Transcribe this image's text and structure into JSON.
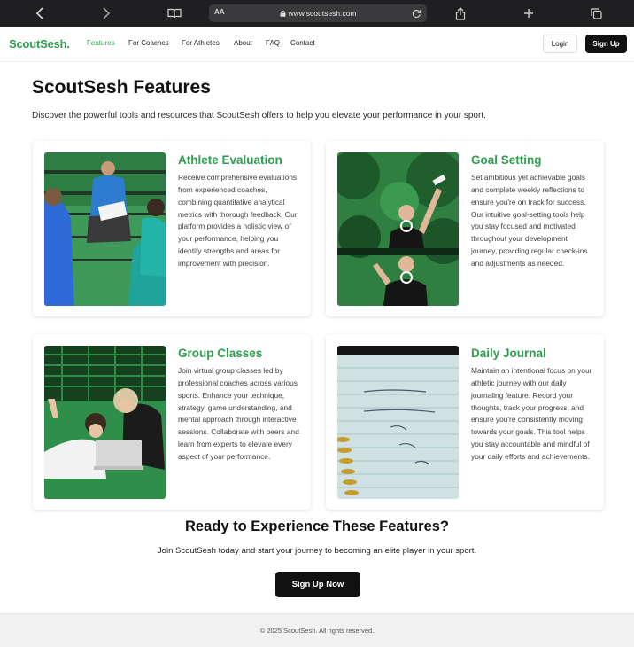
{
  "browser": {
    "text_size_label": "AA",
    "url": "www.scoutsesh.com"
  },
  "nav": {
    "logo": "ScoutSesh.",
    "links": [
      "Features",
      "For Coaches",
      "For Athletes",
      "About",
      "FAQ",
      "Contact"
    ],
    "active_link": "Features",
    "login_label": "Login",
    "signup_label": "Sign Up"
  },
  "page": {
    "title": "ScoutSesh Features",
    "intro": "Discover the powerful tools and resources that ScoutSesh offers to help you elevate your performance in your sport."
  },
  "features": [
    {
      "title": "Athlete Evaluation",
      "description": "Receive comprehensive evaluations from experienced coaches, combining quantitative analytical metrics with thorough feedback. Our platform provides a holistic view of your performance, helping you identify strengths and areas for improvement with precision.",
      "image_alt": "coach-evaluating-athletes-photo"
    },
    {
      "title": "Goal Setting",
      "description": "Set ambitious yet achievable goals and complete weekly reflections to ensure you're on track for success. Our intuitive goal-setting tools help you stay focused and motivated throughout your development journey, providing regular check-ins and adjustments as needed.",
      "image_alt": "athlete-celebrating-photo"
    },
    {
      "title": "Group Classes",
      "description": "Join virtual group classes led by professional coaches across various sports. Enhance your technique, strategy, game understanding, and mental approach through interactive sessions. Collaborate with peers and learn from experts to elevate every aspect of your performance.",
      "image_alt": "athletes-with-laptop-photo"
    },
    {
      "title": "Daily Journal",
      "description": "Maintain an intentional focus on your athletic journey with our daily journaling feature. Record your thoughts, track your progress, and ensure you're consistently moving towards your goals. This tool helps you stay accountable and mindful of your daily efforts and achievements.",
      "image_alt": "journal-notebook-photo"
    }
  ],
  "cta": {
    "title": "Ready to Experience These Features?",
    "text": "Join ScoutSesh today and start your journey to becoming an elite player in your sport.",
    "button": "Sign Up Now"
  },
  "footer": {
    "copyright": "© 2025 ScoutSesh. All rights reserved."
  },
  "colors": {
    "brand_green": "#2f9e4f",
    "button_dark": "#111111"
  }
}
